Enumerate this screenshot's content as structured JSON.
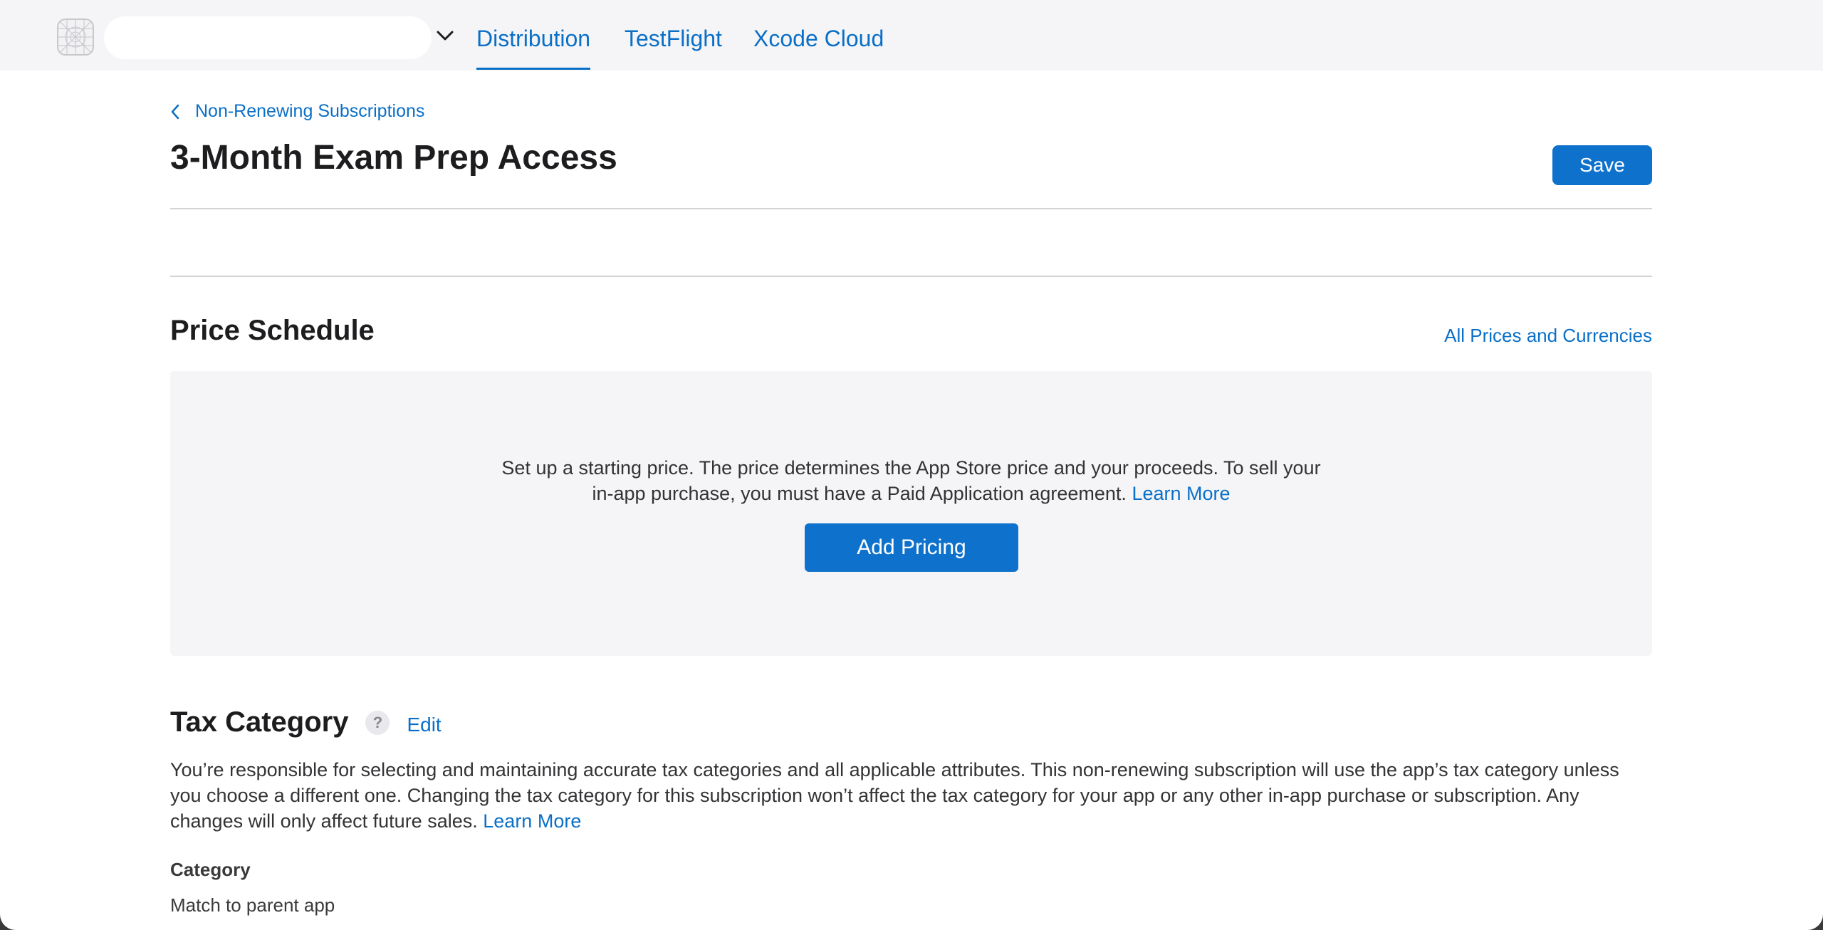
{
  "header": {
    "app_selector_value": "",
    "tabs": [
      {
        "label": "Distribution",
        "active": true
      },
      {
        "label": "TestFlight",
        "active": false
      },
      {
        "label": "Xcode Cloud",
        "active": false
      }
    ],
    "icons": {
      "app": "app-icon-placeholder",
      "dropdown": "chevron-down-icon"
    }
  },
  "breadcrumb": {
    "label": "Non-Renewing Subscriptions",
    "icon": "chevron-left-icon"
  },
  "page": {
    "title": "3-Month Exam Prep Access",
    "save_label": "Save"
  },
  "price_schedule": {
    "title": "Price Schedule",
    "all_prices_link": "All Prices and Currencies",
    "empty_text_line1": "Set up a starting price. The price determines the App Store price and your proceeds. To sell your",
    "empty_text_line2": "in-app purchase, you must have a Paid Application agreement.",
    "learn_more": "Learn More",
    "add_pricing_label": "Add Pricing"
  },
  "tax_category": {
    "title": "Tax Category",
    "help_glyph": "?",
    "edit_label": "Edit",
    "description_line1": "You’re responsible for selecting and maintaining accurate tax categories and all applicable attributes. This non-renewing subscription will use the app’s tax category unless",
    "description_line2": "you choose a different one. Changing the tax category for this subscription won’t affect the tax category for your app or any other in-app purchase or subscription. Any",
    "description_line3": "changes will only affect future sales.",
    "learn_more": "Learn More",
    "category_label": "Category",
    "category_value": "Match to parent app"
  },
  "colors": {
    "accent": "#0a6fc7",
    "button": "#0e72cc",
    "panel": "#f5f5f7",
    "divider": "#d2d2d7"
  }
}
